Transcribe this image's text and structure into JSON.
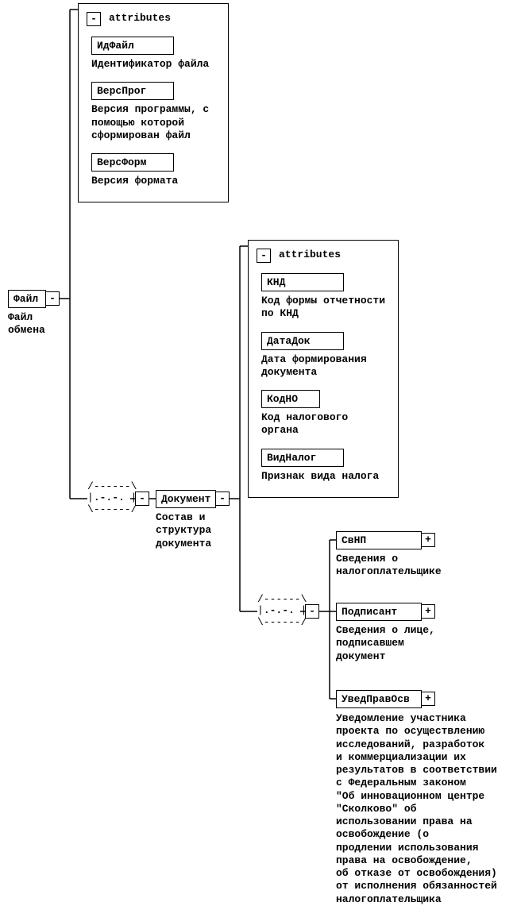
{
  "root": {
    "label": "Файл",
    "desc": "Файл\nобмена"
  },
  "attributes_label": "attributes",
  "toggle_collapse": "-",
  "toggle_expand": "+",
  "seq_text": ".-.-.",
  "file_attrs": [
    {
      "name": "ИдФайл",
      "desc": "Идентификатор файла"
    },
    {
      "name": "ВерсПрог",
      "desc": "Версия программы, с\nпомощью которой\nсформирован файл"
    },
    {
      "name": "ВерсФорм",
      "desc": "Версия формата"
    }
  ],
  "document": {
    "label": "Документ",
    "desc": "Состав и\nструктура\nдокумента"
  },
  "doc_attrs": [
    {
      "name": "КНД",
      "desc": "Код формы отчетности\nпо КНД"
    },
    {
      "name": "ДатаДок",
      "desc": "Дата формирования\nдокумента"
    },
    {
      "name": "КодНО",
      "desc": "Код налогового\nоргана"
    },
    {
      "name": "ВидНалог",
      "desc": "Признак вида налога"
    }
  ],
  "doc_children": [
    {
      "name": "СвНП",
      "desc": "Сведения о\nналогоплательщике"
    },
    {
      "name": "Подписант",
      "desc": "Сведения о лице,\nподписавшем\nдокумент"
    },
    {
      "name": "УведПравОсв",
      "desc": "Уведомление участника\nпроекта по осуществлению\nисследований, разработок\nи коммерциализации их\nрезультатов в соответствии\nс Федеральным законом\n\"Об инновационном центре\n\"Сколково\" об\nиспользовании права на\nосвобождение (о\nпродлении использования\nправа на освобождение,\nоб отказе от освобождения)\nот исполнения обязанностей\nналогоплательщика"
    }
  ]
}
